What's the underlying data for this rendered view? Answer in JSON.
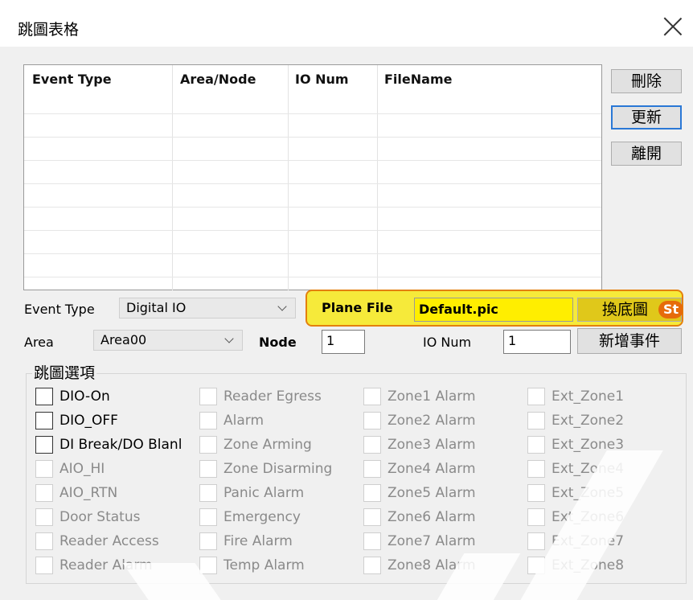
{
  "window": {
    "title": "跳圖表格"
  },
  "list": {
    "columns": [
      "Event Type",
      "Area/Node",
      "IO Num",
      "FileName"
    ]
  },
  "buttons": {
    "delete": "刪除",
    "update": "更新",
    "exit": "離開",
    "change_bg": "換底圖",
    "add_event": "新增事件"
  },
  "form": {
    "event_type_label": "Event Type",
    "event_type_value": "Digital IO",
    "area_label": "Area",
    "area_value": "Area00",
    "node_label": "Node",
    "node_value": "1",
    "plane_file_label": "Plane File",
    "plane_file_value": "Default.pic",
    "io_num_label": "IO Num",
    "io_num_value": "1"
  },
  "step_badge": "St",
  "options": {
    "group_label": "跳圖選項",
    "columns": [
      [
        "DIO-On",
        "DIO_OFF",
        "DI Break/DO Blanl",
        "AIO_HI",
        "AIO_RTN",
        "Door Status",
        "Reader Access",
        "Reader Alarm"
      ],
      [
        "Reader Egress",
        "Alarm",
        "Zone Arming",
        "Zone Disarming",
        "Panic Alarm",
        "Emergency",
        "Fire Alarm",
        "Temp Alarm"
      ],
      [
        "Zone1 Alarm",
        "Zone2 Alarm",
        "Zone3 Alarm",
        "Zone4 Alarm",
        "Zone5 Alarm",
        "Zone6 Alarm",
        "Zone7 Alarm",
        "Zone8 Alarm"
      ],
      [
        "Ext_Zone1",
        "Ext_Zone2",
        "Ext_Zone3",
        "Ext_Zone4",
        "Ext_Zone5",
        "Ext_Zone6",
        "Ext_Zone7",
        "Ext_Zone8"
      ]
    ],
    "enabled": [
      "DIO-On",
      "DIO_OFF",
      "DI Break/DO Blanl"
    ]
  },
  "colors": {
    "highlight": "#f6ea3a",
    "highlight_border": "#e4800e",
    "focus": "#2a78d6"
  }
}
